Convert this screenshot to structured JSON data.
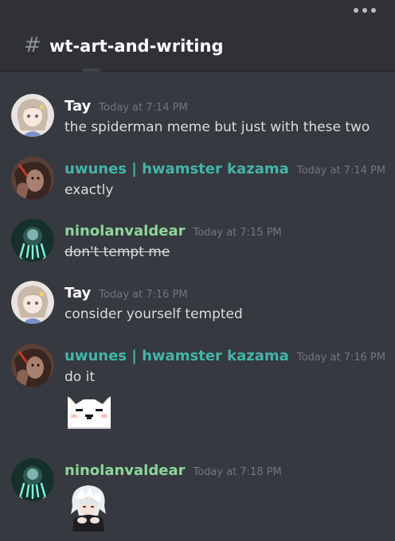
{
  "channel": {
    "hash": "#",
    "name": "wt-art-and-writing"
  },
  "colors": {
    "background": "#36393f",
    "header": "#2f3136",
    "tay": "#ffffff",
    "uwunes": "#43b5a8",
    "nino": "#8ed59b",
    "timestamp": "#72767d"
  },
  "messages": [
    {
      "author": "Tay",
      "timestamp": "Today at 7:14 PM",
      "text": "the spiderman meme but just with these two"
    },
    {
      "author": "uwunes | hwamster kazama",
      "timestamp": "Today at 7:14 PM",
      "text": "exactly"
    },
    {
      "author": "ninolanvaldear",
      "timestamp": "Today at 7:15 PM",
      "text": "don't tempt me"
    },
    {
      "author": "Tay",
      "timestamp": "Today at 7:16 PM",
      "text": "consider yourself tempted"
    },
    {
      "author": "uwunes | hwamster kazama",
      "timestamp": "Today at 7:16 PM",
      "text": "do it",
      "emoji": "pixel-cat-emoji"
    },
    {
      "author": "ninolanvaldear",
      "timestamp": "Today at 7:18 PM",
      "emoji": "anime-boy-emoji"
    }
  ]
}
